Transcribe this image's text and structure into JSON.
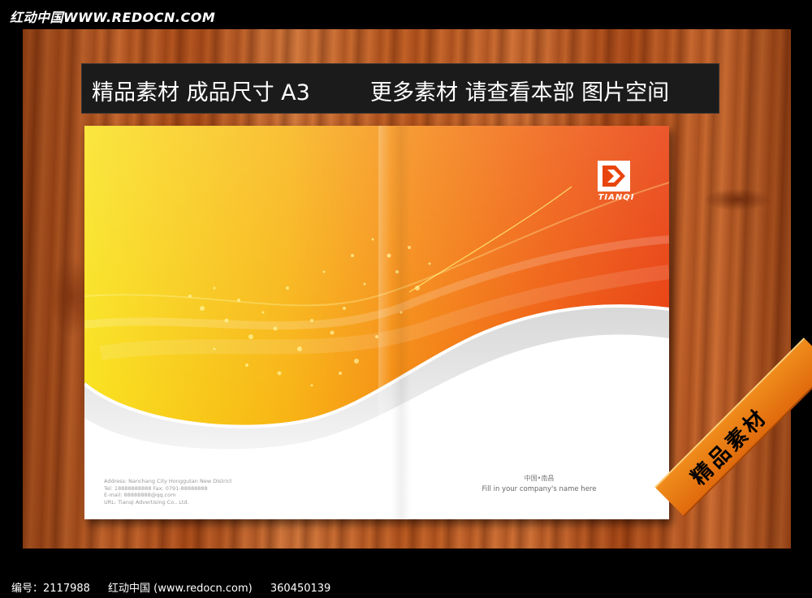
{
  "header": {
    "watermark": "红动中国WWW.REDOCN.COM"
  },
  "banner": {
    "text_left": "精品素材 成品尺寸 A3",
    "text_right": "更多素材 请查看本部 图片空间"
  },
  "cover": {
    "logo_text": "TIANQI",
    "contact_lines": [
      "Address: Nanchang City Honggutan New District",
      "Tel: 18888888888     Fax: 0791-88888888",
      "E-mail: 88888888@qq.com",
      "URL: Tianqi Advertising Co., Ltd."
    ],
    "city": "中国•南昌",
    "company_placeholder": "Fill in your company's name here"
  },
  "ribbon": {
    "text": "精品素材"
  },
  "footer": {
    "id_label": "编号：2117988",
    "site": "红动中国 (www.redocn.com)",
    "number": "360450139"
  },
  "colors": {
    "cover_yellow": "#f8d820",
    "cover_orange": "#f27a10",
    "cover_red": "#e93d08",
    "banner_bg": "#1b1b1b",
    "ribbon_orange": "#ef8418"
  }
}
